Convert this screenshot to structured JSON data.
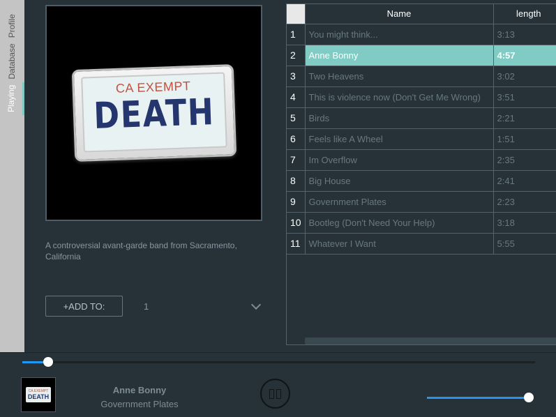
{
  "sidebar": {
    "tabs": [
      {
        "label": "Playing"
      },
      {
        "label": "Database"
      },
      {
        "label": "Profile"
      }
    ]
  },
  "album_art": {
    "plate_top": "CA EXEMPT",
    "plate_main": "DEATH"
  },
  "artist": {
    "description": "A controversial avant-garde band from Sacramento, California"
  },
  "add_to": {
    "button_label": "+ADD TO:",
    "selected_value": "1"
  },
  "tracklist": {
    "columns": {
      "name": "Name",
      "length": "length"
    },
    "selected_index": 1,
    "rows": [
      {
        "num": "1",
        "name": "You might think...",
        "length": "3:13"
      },
      {
        "num": "2",
        "name": "Anne Bonny",
        "length": "4:57"
      },
      {
        "num": "3",
        "name": "Two Heavens",
        "length": "3:02"
      },
      {
        "num": "4",
        "name": "This is violence now (Don't Get Me Wrong)",
        "length": "3:51"
      },
      {
        "num": "5",
        "name": "Birds",
        "length": "2:21"
      },
      {
        "num": "6",
        "name": "Feels like A Wheel",
        "length": "1:51"
      },
      {
        "num": "7",
        "name": "Im Overflow",
        "length": "2:35"
      },
      {
        "num": "8",
        "name": "Big House",
        "length": "2:41"
      },
      {
        "num": "9",
        "name": "Government Plates",
        "length": "2:23"
      },
      {
        "num": "10",
        "name": "Bootleg (Don't Need Your Help)",
        "length": "3:18"
      },
      {
        "num": "11",
        "name": "Whatever I Want",
        "length": "5:55"
      }
    ]
  },
  "player": {
    "track_title": "Anne Bonny",
    "album_title": "Government Plates",
    "thumb_top": "CA EXEMPT",
    "thumb_main": "DEATH",
    "seek_fraction": 0.05,
    "volume_fraction": 1.0,
    "accent_color": "#2196f3",
    "pause_icon": "pause-icon"
  }
}
